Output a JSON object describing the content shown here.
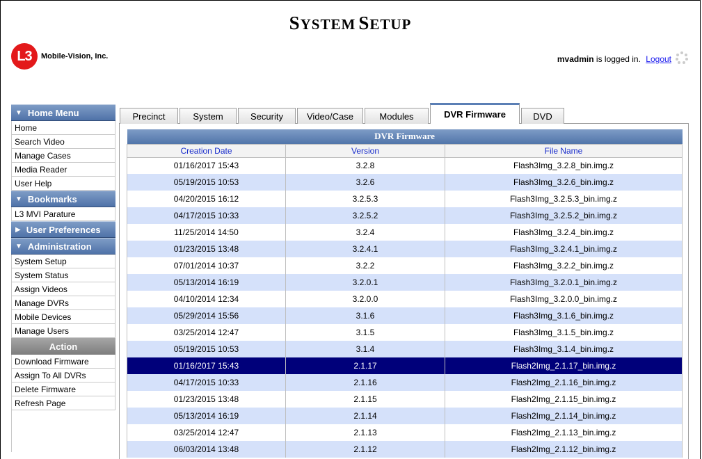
{
  "page": {
    "title_first_big": "S",
    "title_first_rest": "YSTEM",
    "title_second_big": "S",
    "title_second_rest": "ETUP"
  },
  "brand": {
    "logo_mark": "L3",
    "company": "Mobile-Vision, Inc."
  },
  "user": {
    "username": "mvadmin",
    "status_text": " is logged in.",
    "logout_label": "Logout"
  },
  "sidebar": {
    "home_menu": {
      "label": "Home Menu",
      "items": [
        "Home",
        "Search Video",
        "Manage Cases",
        "Media Reader",
        "User Help"
      ]
    },
    "bookmarks": {
      "label": "Bookmarks",
      "items": [
        "L3 MVI Parature"
      ]
    },
    "user_preferences": {
      "label": "User Preferences"
    },
    "administration": {
      "label": "Administration",
      "items": [
        "System Setup",
        "System Status",
        "Assign Videos",
        "Manage DVRs",
        "Mobile Devices",
        "Manage Users"
      ]
    },
    "action": {
      "label": "Action",
      "items": [
        "Download Firmware",
        "Assign To All DVRs",
        "Delete Firmware",
        "Refresh Page"
      ]
    }
  },
  "tabs": [
    "Precinct",
    "System",
    "Security",
    "Video/Case",
    "Modules",
    "DVR Firmware",
    "DVD"
  ],
  "active_tab": "DVR Firmware",
  "table": {
    "caption": "DVR Firmware",
    "columns": [
      "Creation Date",
      "Version",
      "File Name"
    ],
    "selected_row": 13,
    "rows": [
      [
        "01/16/2017 15:43",
        "3.2.8",
        "Flash3Img_3.2.8_bin.img.z"
      ],
      [
        "05/19/2015 10:53",
        "3.2.6",
        "Flash3Img_3.2.6_bin.img.z"
      ],
      [
        "04/20/2015 16:12",
        "3.2.5.3",
        "Flash3Img_3.2.5.3_bin.img.z"
      ],
      [
        "04/17/2015 10:33",
        "3.2.5.2",
        "Flash3Img_3.2.5.2_bin.img.z"
      ],
      [
        "11/25/2014 14:50",
        "3.2.4",
        "Flash3Img_3.2.4_bin.img.z"
      ],
      [
        "01/23/2015 13:48",
        "3.2.4.1",
        "Flash3Img_3.2.4.1_bin.img.z"
      ],
      [
        "07/01/2014 10:37",
        "3.2.2",
        "Flash3Img_3.2.2_bin.img.z"
      ],
      [
        "05/13/2014 16:19",
        "3.2.0.1",
        "Flash3Img_3.2.0.1_bin.img.z"
      ],
      [
        "04/10/2014 12:34",
        "3.2.0.0",
        "Flash3Img_3.2.0.0_bin.img.z"
      ],
      [
        "05/29/2014 15:56",
        "3.1.6",
        "Flash3Img_3.1.6_bin.img.z"
      ],
      [
        "03/25/2014 12:47",
        "3.1.5",
        "Flash3Img_3.1.5_bin.img.z"
      ],
      [
        "05/19/2015 10:53",
        "3.1.4",
        "Flash3Img_3.1.4_bin.img.z"
      ],
      [
        "01/16/2017 15:43",
        "2.1.17",
        "Flash2Img_2.1.17_bin.img.z"
      ],
      [
        "04/17/2015 10:33",
        "2.1.16",
        "Flash2Img_2.1.16_bin.img.z"
      ],
      [
        "01/23/2015 13:48",
        "2.1.15",
        "Flash2Img_2.1.15_bin.img.z"
      ],
      [
        "05/13/2014 16:19",
        "2.1.14",
        "Flash2Img_2.1.14_bin.img.z"
      ],
      [
        "03/25/2014 12:47",
        "2.1.13",
        "Flash2Img_2.1.13_bin.img.z"
      ],
      [
        "06/03/2014 13:48",
        "2.1.12",
        "Flash2Img_2.1.12_bin.img.z"
      ]
    ]
  },
  "colors": {
    "header_blue": "#5b7fb5",
    "row_alt": "#d5e1fa",
    "selected_row": "#00007a",
    "link": "#1a1aee",
    "logo_red": "#e3191b"
  }
}
